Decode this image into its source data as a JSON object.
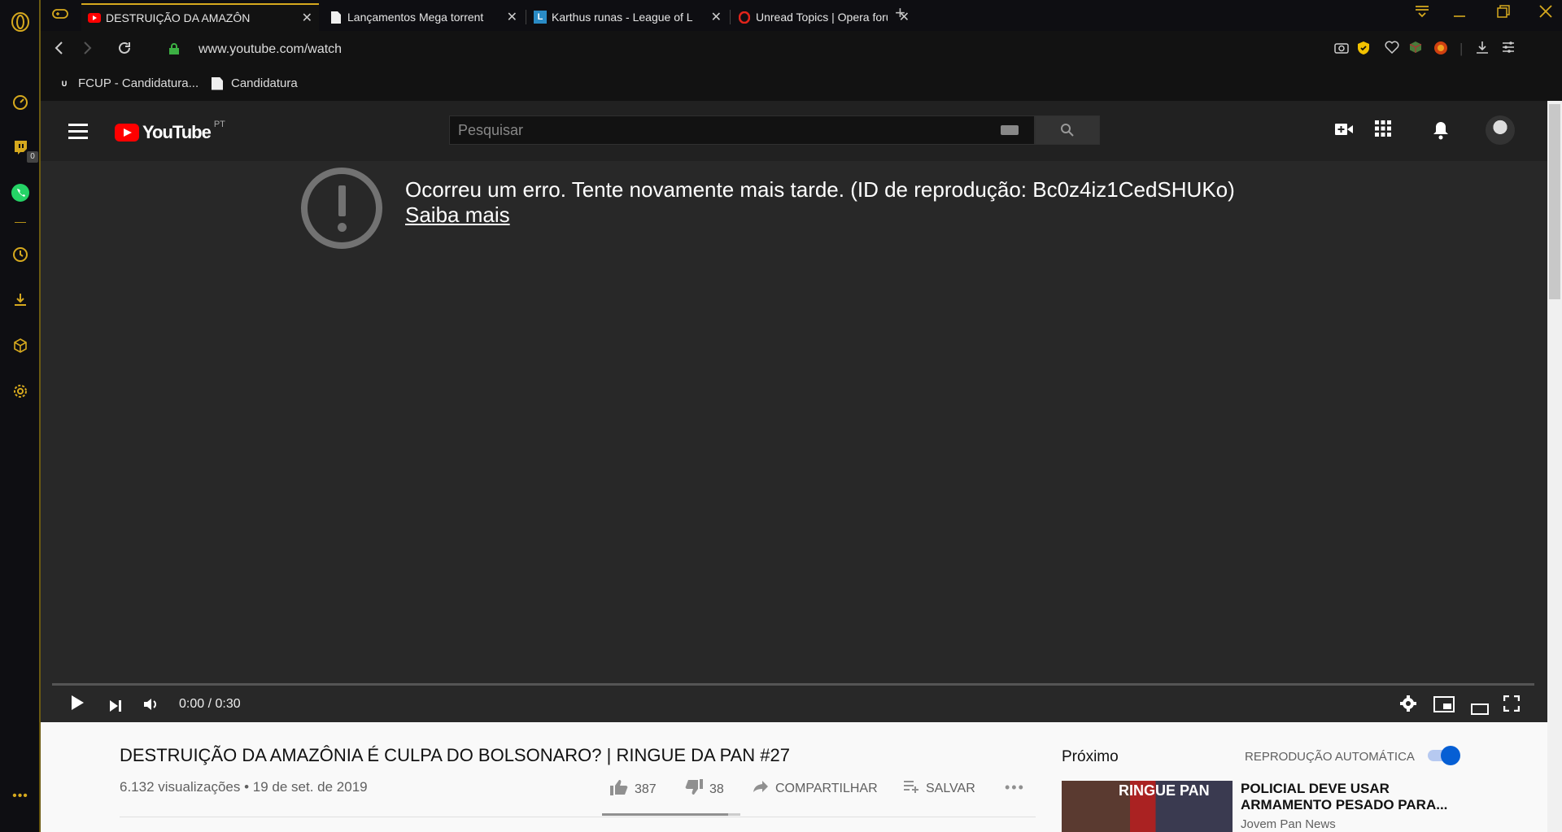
{
  "browser": {
    "tabs": [
      {
        "title": "DESTRUIÇÃO DA AMAZÔN",
        "favicon": "youtube-icon",
        "active": true
      },
      {
        "title": "Lançamentos Mega torrent",
        "favicon": "page-icon",
        "active": false
      },
      {
        "title": "Karthus runas - League of L",
        "favicon": "L",
        "active": false
      },
      {
        "title": "Unread Topics | Opera forur",
        "favicon": "opera-icon",
        "active": false
      }
    ],
    "url": "www.youtube.com/watch",
    "bookmarks": [
      {
        "label": "FCUP - Candidatura..."
      },
      {
        "label": "Candidatura"
      }
    ],
    "sidebar_badge": "0",
    "accent_color": "#d6a91e"
  },
  "youtube": {
    "country": "PT",
    "search_placeholder": "Pesquisar",
    "error_message": "Ocorreu um erro. Tente novamente mais tarde. (ID de reprodução: Bc0z4iz1CedSHUKo)",
    "error_link": "Saiba mais",
    "time": "0:00 / 0:30",
    "video_title": "DESTRUIÇÃO DA AMAZÔNIA É CULPA DO BOLSONARO? | RINGUE DA PAN #27",
    "meta": "6.132 visualizações • 19 de set. de 2019",
    "likes": "387",
    "dislikes": "38",
    "share": "COMPARTILHAR",
    "save": "SALVAR",
    "up_next": "Próximo",
    "autoplay": "REPRODUÇÃO AUTOMÁTICA",
    "autoplay_on": true,
    "next_video": {
      "title": "POLICIAL DEVE USAR ARMAMENTO PESADO PARA...",
      "channel": "Jovem Pan News",
      "thumb_text": "RINGUE PAN"
    }
  }
}
